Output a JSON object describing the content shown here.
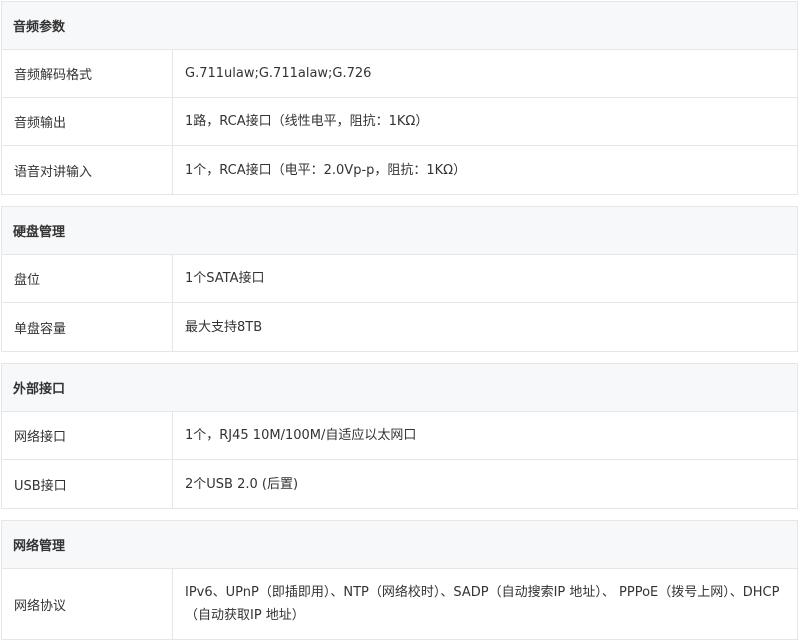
{
  "sections": [
    {
      "title": "音频参数",
      "rows": [
        {
          "label": "音频解码格式",
          "value": "G.711ulaw;G.711alaw;G.726"
        },
        {
          "label": "音频输出",
          "value": "1路，RCA接口（线性电平，阻抗：1KΩ）"
        },
        {
          "label": "语音对讲输入",
          "value": "1个，RCA接口（电平：2.0Vp-p，阻抗：1KΩ）"
        }
      ]
    },
    {
      "title": "硬盘管理",
      "rows": [
        {
          "label": "盘位",
          "value": "1个SATA接口"
        },
        {
          "label": "单盘容量",
          "value": "最大支持8TB"
        }
      ]
    },
    {
      "title": "外部接口",
      "rows": [
        {
          "label": "网络接口",
          "value": "1个，RJ45 10M/100M/自适应以太网口"
        },
        {
          "label": "USB接口",
          "value": "2个USB 2.0 (后置)"
        }
      ]
    },
    {
      "title": "网络管理",
      "rows": [
        {
          "label": "网络协议",
          "value": "IPv6、UPnP（即插即用）、NTP（网络校时）、SADP（自动搜索IP 地址）、 PPPoE（拨号上网）、DHCP（自动获取IP 地址）"
        }
      ]
    }
  ]
}
